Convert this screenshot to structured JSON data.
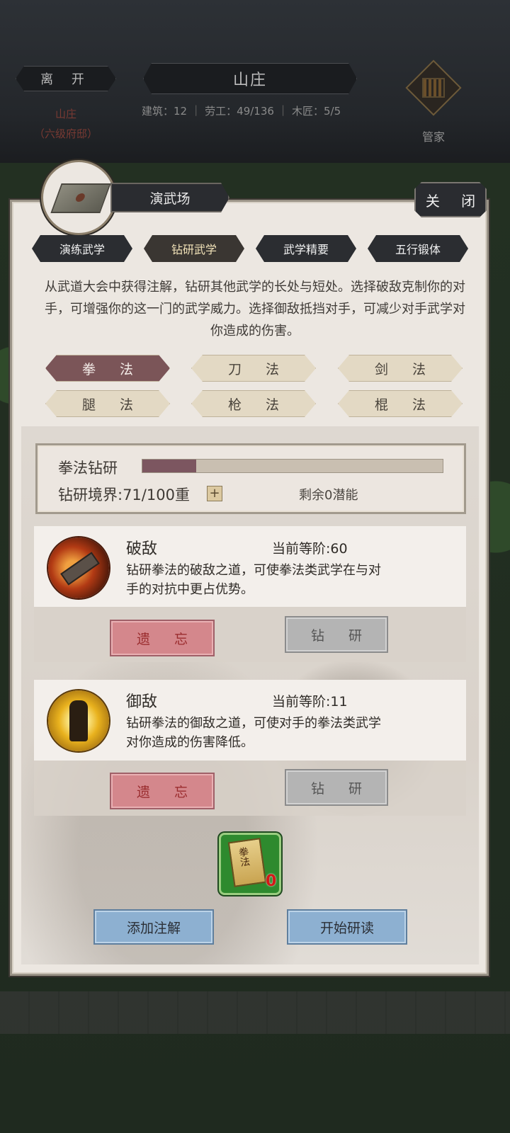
{
  "header": {
    "leave_label": "离 开",
    "title": "山庄",
    "location_name": "山庄",
    "location_rank": "（六级府邸）",
    "stats": {
      "buildings": "建筑：12",
      "laborers": "劳工：49/136",
      "carpenters": "木匠：5/5"
    },
    "steward_label": "管家",
    "steward_icon": "abacus-icon"
  },
  "panel": {
    "title": "演武场",
    "close_label": "关 闭",
    "tabs": [
      {
        "label": "演练武学",
        "active": false
      },
      {
        "label": "钻研武学",
        "active": true
      },
      {
        "label": "武学精要",
        "active": false
      },
      {
        "label": "五行锻体",
        "active": false
      }
    ],
    "description": "从武道大会中获得注解，钻研其他武学的长处与短处。选择破敌克制你的对手，可增强你的这一门的武学威力。选择御敌抵挡对手，可减少对手武学对你造成的伤害。",
    "styles": [
      {
        "label": "拳 法",
        "selected": true
      },
      {
        "label": "刀 法",
        "selected": false
      },
      {
        "label": "剑 法",
        "selected": false
      },
      {
        "label": "腿 法",
        "selected": false
      },
      {
        "label": "枪 法",
        "selected": false
      },
      {
        "label": "棍 法",
        "selected": false
      }
    ],
    "progress": {
      "label": "拳法钻研",
      "fraction": 0.18,
      "realm": "钻研境界:71/100重",
      "plus": "+",
      "potential": "剩余0潜能"
    },
    "skills": [
      {
        "name": "破敌",
        "level": "当前等阶:60",
        "desc_line1": "钻研拳法的破敌之道，可使拳法类武学在与对",
        "desc_line2": "手的对抗中更占优势。",
        "forget_label": "遗 忘",
        "study_label": "钻 研",
        "icon": "mace-strike-icon"
      },
      {
        "name": "御敌",
        "level": "当前等阶:11",
        "desc_line1": "钻研拳法的御敌之道，可使对手的拳法类武学",
        "desc_line2": "对你造成的伤害降低。",
        "forget_label": "遗 忘",
        "study_label": "钻 研",
        "icon": "guard-stance-icon"
      }
    ],
    "item": {
      "icon": "manual-scroll-icon",
      "scroll_text": "拳法",
      "count": "0"
    },
    "add_annotation_label": "添加注解",
    "start_study_label": "开始研读",
    "colors": {
      "selected_style": "#7b5558",
      "progress_fill": "#7c5660",
      "forget_button": "#d4878c",
      "action_button": "#8db0d1",
      "item_slot": "#2e8a2e"
    }
  }
}
